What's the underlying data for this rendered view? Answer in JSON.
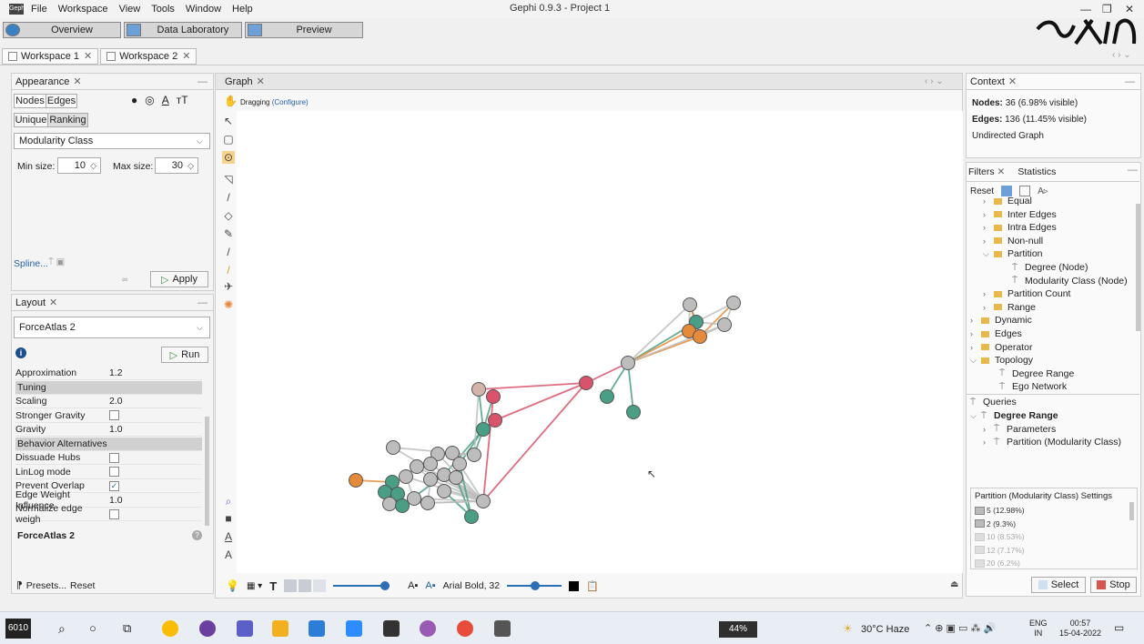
{
  "menubar": {
    "app_icon_text": "Gephi",
    "items": [
      "File",
      "Workspace",
      "View",
      "Tools",
      "Window",
      "Help"
    ],
    "title": "Gephi 0.9.3 - Project 1",
    "controls": [
      "—",
      "❐",
      "✕"
    ]
  },
  "modes": [
    "Overview",
    "Data Laboratory",
    "Preview"
  ],
  "workspaces": [
    "Workspace 1",
    "Workspace 2"
  ],
  "appearance": {
    "tab": "Appearance",
    "targets": [
      "Nodes",
      "Edges"
    ],
    "modes": [
      "Unique",
      "Ranking"
    ],
    "attribute": "Modularity Class",
    "min_label": "Min size:",
    "min_value": "10",
    "max_label": "Max size:",
    "max_value": "30",
    "spline": "Spline...",
    "apply": "Apply"
  },
  "layout": {
    "tab": "Layout",
    "algorithm": "ForceAtlas 2",
    "run": "Run",
    "props": [
      {
        "k": "Approximation",
        "v": "1.2"
      },
      {
        "k": "Tuning",
        "group": true
      },
      {
        "k": "Scaling",
        "v": "2.0"
      },
      {
        "k": "Stronger Gravity",
        "cb": false
      },
      {
        "k": "Gravity",
        "v": "1.0"
      },
      {
        "k": "Behavior Alternatives",
        "group": true
      },
      {
        "k": "Dissuade Hubs",
        "cb": false
      },
      {
        "k": "LinLog mode",
        "cb": false
      },
      {
        "k": "Prevent Overlap",
        "cb": true
      },
      {
        "k": "Edge Weight Influence",
        "v": "1.0"
      },
      {
        "k": "Normalize edge weigh",
        "cb": false
      }
    ],
    "footer_title": "ForceAtlas 2",
    "presets": "Presets...",
    "reset": "Reset"
  },
  "graph": {
    "tab": "Graph",
    "mode": "Dragging",
    "configure": "(Configure)",
    "font_label": "Arial Bold, 32"
  },
  "context": {
    "tab": "Context",
    "nodes_label": "Nodes:",
    "nodes_value": "36 (6.98% visible)",
    "edges_label": "Edges:",
    "edges_value": "136 (11.45% visible)",
    "type": "Undirected Graph"
  },
  "filters": {
    "tabs": [
      "Filters",
      "Statistics"
    ],
    "reset": "Reset",
    "tree": [
      {
        "t": "Equal",
        "lvl": 1,
        "kind": "folder"
      },
      {
        "t": "Inter Edges",
        "lvl": 1,
        "kind": "folder"
      },
      {
        "t": "Intra Edges",
        "lvl": 1,
        "kind": "folder"
      },
      {
        "t": "Non-null",
        "lvl": 1,
        "kind": "folder"
      },
      {
        "t": "Partition",
        "lvl": 1,
        "kind": "folder",
        "open": true
      },
      {
        "t": "Degree (Node)",
        "lvl": 2,
        "kind": "filter"
      },
      {
        "t": "Modularity Class (Node)",
        "lvl": 2,
        "kind": "filter"
      },
      {
        "t": "Partition Count",
        "lvl": 1,
        "kind": "folder"
      },
      {
        "t": "Range",
        "lvl": 1,
        "kind": "folder"
      },
      {
        "t": "Dynamic",
        "lvl": 0,
        "kind": "folder"
      },
      {
        "t": "Edges",
        "lvl": 0,
        "kind": "folder"
      },
      {
        "t": "Operator",
        "lvl": 0,
        "kind": "folder"
      },
      {
        "t": "Topology",
        "lvl": 0,
        "kind": "folder",
        "open": true
      },
      {
        "t": "Degree Range",
        "lvl": 1,
        "kind": "filter"
      },
      {
        "t": "Ego Network",
        "lvl": 1,
        "kind": "filter"
      }
    ],
    "queries_label": "Queries",
    "query_tree": [
      {
        "t": "Degree Range",
        "lvl": 0,
        "bold": true,
        "open": true
      },
      {
        "t": "Parameters",
        "lvl": 1
      },
      {
        "t": "Partition (Modularity Class)",
        "lvl": 1
      }
    ],
    "partition_title": "Partition (Modularity Class) Settings",
    "partitions": [
      {
        "t": "5 (12.98%)",
        "dim": false
      },
      {
        "t": "2 (9.3%)",
        "dim": false
      },
      {
        "t": "10 (8.53%)",
        "dim": true
      },
      {
        "t": "12 (7.17%)",
        "dim": true
      },
      {
        "t": "20 (6.2%)",
        "dim": true
      }
    ],
    "select": "Select",
    "stop": "Stop"
  },
  "taskbar": {
    "start_label": "6010",
    "battery": "44%",
    "weather": "30°C Haze",
    "lang": "ENG",
    "region": "IN",
    "time": "00:57",
    "date": "15-04-2022"
  },
  "colors": {
    "teal": "#4a9e85",
    "grey": "#bdbdbd",
    "orange": "#e58a3a",
    "pink": "#d9536a",
    "tan": "#d2b4a8"
  }
}
